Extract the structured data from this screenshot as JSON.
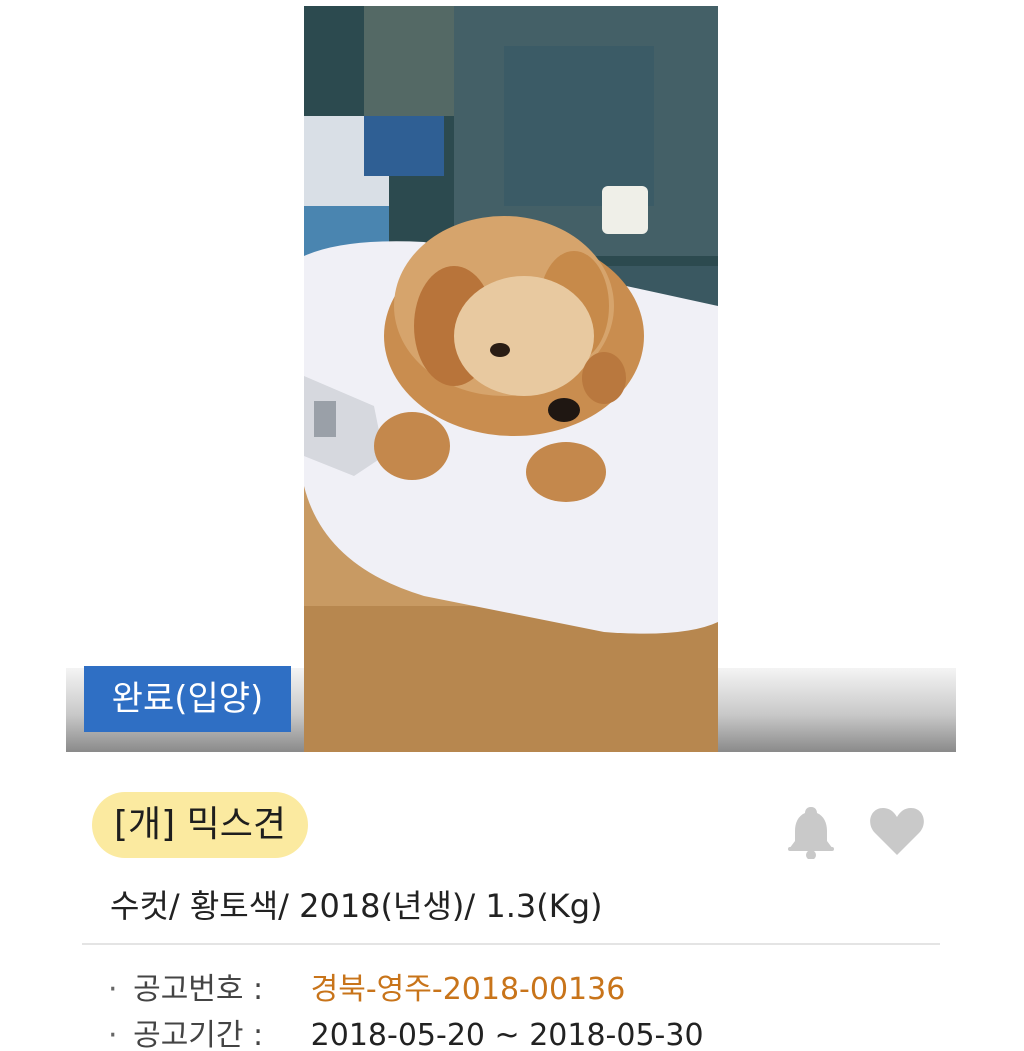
{
  "listing": {
    "status": "완료(입양)",
    "title": "[개] 믹스견",
    "summary": "수컷/ 황토색/ 2018(년생)/ 1.3(Kg)",
    "notice_number_label": "공고번호 :",
    "notice_number": "경북-영주-2018-00136",
    "notice_period_label": "공고기간 :",
    "notice_period": "2018-05-20 ~ 2018-05-30",
    "bullet": "·"
  },
  "icons": {
    "bell": "bell-icon",
    "heart": "heart-icon"
  },
  "colors": {
    "status_badge": "#2f6fc4",
    "title_pill": "#fbeaa0",
    "notice_number": "#c8741a",
    "icon_gray": "#c9c9c9"
  }
}
